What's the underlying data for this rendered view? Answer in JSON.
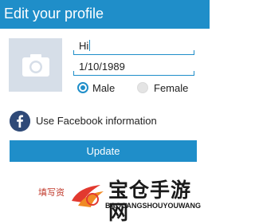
{
  "header": {
    "title": "Edit your profile"
  },
  "form": {
    "name_value": "Hi",
    "dob_value": "1/10/1989",
    "gender": {
      "selected": "Male",
      "options": [
        "Male",
        "Female"
      ]
    },
    "facebook_label": "Use Facebook information",
    "update_label": "Update"
  },
  "icons": {
    "photo": "camera-icon",
    "facebook": "facebook-icon"
  },
  "watermark": {
    "left_text": "填写资",
    "title": "宝仓手游网",
    "subtitle": "BAOCANGSHOUYOUWANG"
  },
  "colors": {
    "accent": "#1f8ec9",
    "photo_placeholder": "#d6dee8",
    "facebook": "#2f4a78"
  }
}
